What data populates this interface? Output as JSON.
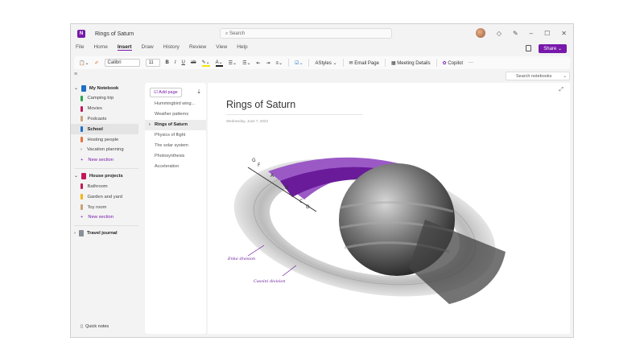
{
  "app": {
    "title": "Rings of Saturn",
    "search_placeholder": "Search",
    "share": "Share ⌄"
  },
  "menu": [
    "File",
    "Home",
    "Insert",
    "Draw",
    "History",
    "Review",
    "View",
    "Help"
  ],
  "ribbon": {
    "font": "Calibri",
    "size": "11",
    "styles": "Styles",
    "email": "Email Page",
    "meeting": "Meeting Details",
    "copilot": "Copilot",
    "more": "···"
  },
  "search_notebooks": "Search notebooks",
  "notebooks": [
    {
      "name": "My Notebook",
      "color": "#1f6fc5",
      "sections": [
        {
          "name": "Camping trip",
          "color": "#2da44e"
        },
        {
          "name": "Movies",
          "color": "#c2185b"
        },
        {
          "name": "Podcasts",
          "color": "#c8a27a"
        },
        {
          "name": "School",
          "color": "#1f6fc5",
          "selected": true
        },
        {
          "name": "Hosting people",
          "color": "#e8743b"
        },
        {
          "name": "Vacation planning",
          "color": "",
          "group": true
        }
      ],
      "new_section": "New section"
    },
    {
      "name": "House projects",
      "color": "#c2185b",
      "sections": [
        {
          "name": "Bathroom",
          "color": "#c2185b"
        },
        {
          "name": "Garden and yard",
          "color": "#f2b50f"
        },
        {
          "name": "Toy room",
          "color": "#c8a27a"
        }
      ],
      "new_section": "New section"
    },
    {
      "name": "Travel journal",
      "color": "#8a9099"
    }
  ],
  "quick_notes": "Quick notes",
  "pages": {
    "add": "Add page",
    "items": [
      "Hummingbird wing...",
      "Weather patterns",
      "Rings of Saturn",
      "Physics of flight",
      "The solar system",
      "Photosynthesis",
      "Acceleration"
    ],
    "selected": 2
  },
  "page": {
    "title": "Rings of Saturn",
    "date": "Wednesday, June 7, 2023",
    "ring_labels": [
      "G",
      "F",
      "A",
      "B",
      "C",
      "D"
    ],
    "annotations": [
      "Enke division",
      "Cassini division"
    ]
  },
  "colors": {
    "accent": "#7719aa"
  }
}
